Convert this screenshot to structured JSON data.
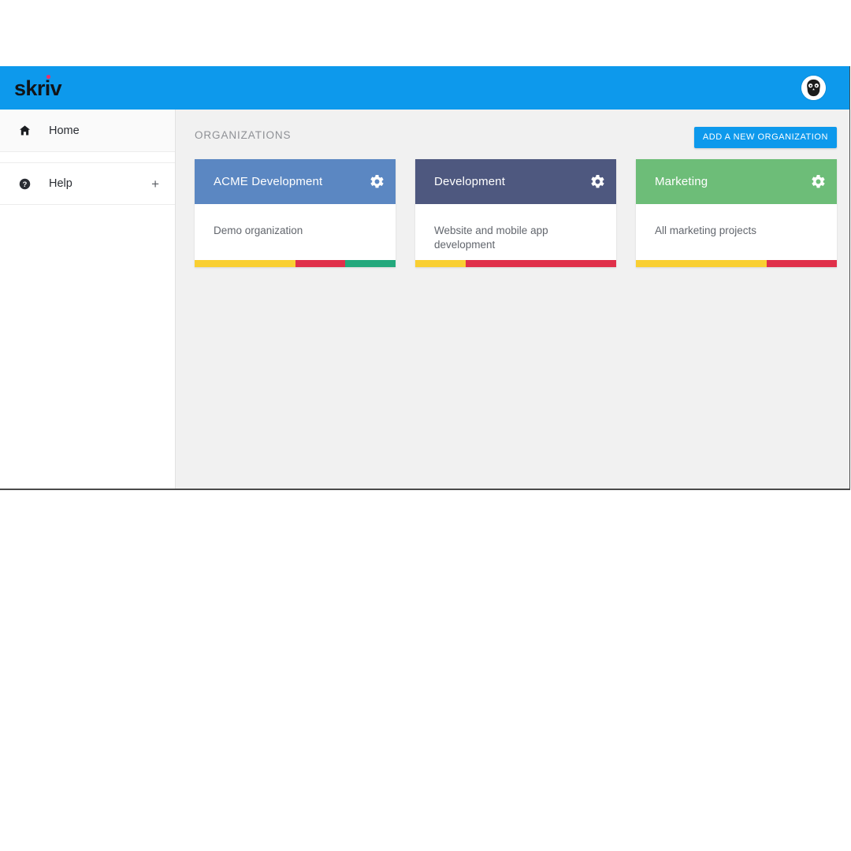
{
  "app": {
    "brand": "skriv",
    "brand_dot_color": "#e8326d",
    "topbar_color": "#0d99ec",
    "avatar_icon": "user-avatar-image"
  },
  "sidebar": {
    "items": [
      {
        "label": "Home",
        "icon": "home-icon",
        "active": true,
        "expand": null
      },
      {
        "label": "Help",
        "icon": "help-circle-icon",
        "active": false,
        "expand": "+"
      }
    ]
  },
  "main": {
    "section_title": "ORGANIZATIONS",
    "add_button_label": "ADD A NEW ORGANIZATION",
    "add_button_color": "#0d99ec",
    "gear_icon": "gear-icon",
    "organizations": [
      {
        "title": "ACME Development",
        "description": "Demo organization",
        "header_color": "#5b87c2",
        "bar": [
          {
            "color": "#f9cf32",
            "percent": 50
          },
          {
            "color": "#e0304a",
            "percent": 25
          },
          {
            "color": "#23a87c",
            "percent": 25
          }
        ]
      },
      {
        "title": "Development",
        "description": "Website and mobile app development",
        "header_color": "#4e587f",
        "bar": [
          {
            "color": "#f9cf32",
            "percent": 25
          },
          {
            "color": "#e0304a",
            "percent": 75
          }
        ]
      },
      {
        "title": "Marketing",
        "description": "All marketing projects",
        "header_color": "#6dbd78",
        "bar": [
          {
            "color": "#f9cf32",
            "percent": 65
          },
          {
            "color": "#e0304a",
            "percent": 35
          }
        ]
      }
    ]
  }
}
